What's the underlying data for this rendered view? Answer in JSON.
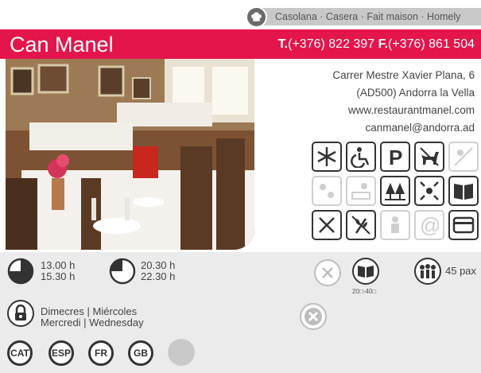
{
  "cuisine": "Casolana · Casera · Fait maison · Homely",
  "restaurant": {
    "name": "Can Manel"
  },
  "phones": {
    "t_label": "T.",
    "t_number": "(+376) 822 397",
    "f_label": "F.",
    "f_number": "(+376) 861 504"
  },
  "address": {
    "line1": "Carrer Mestre Xavier Plana, 6",
    "line2": "(AD500) Andorra la Vella",
    "web": "www.restaurantmanel.com",
    "email": "canmanel@andorra.ad"
  },
  "services": [
    {
      "icon": "snowflake-icon",
      "active": true
    },
    {
      "icon": "wheelchair-icon",
      "active": true
    },
    {
      "icon": "parking-icon",
      "active": true
    },
    {
      "icon": "dog-icon",
      "active": true
    },
    {
      "icon": "terrace-icon",
      "active": false
    },
    {
      "icon": "sun-icon",
      "active": false
    },
    {
      "icon": "terrace-view-icon",
      "active": false
    },
    {
      "icon": "trees-icon",
      "active": true
    },
    {
      "icon": "kids-icon",
      "active": true
    },
    {
      "icon": "menu-book-icon",
      "active": true
    },
    {
      "icon": "cutlery-icon",
      "active": true
    },
    {
      "icon": "gluten-free-icon",
      "active": true
    },
    {
      "icon": "chef-icon",
      "active": false
    },
    {
      "icon": "at-icon",
      "active": false
    },
    {
      "icon": "credit-card-icon",
      "active": true
    }
  ],
  "hours": {
    "lunch_open": "13.00 h",
    "lunch_close": "15.30 h",
    "dinner_open": "20.30 h",
    "dinner_close": "22.30 h"
  },
  "menu_price": "20□-40□",
  "capacity": "45 pax",
  "closed": {
    "line1": "Dimecres | Miércoles",
    "line2": "Mercredi | Wednesday"
  },
  "languages": [
    "CAT",
    "ESP",
    "FR",
    "GB"
  ],
  "colors": {
    "brand": "#e4154b",
    "panel": "#ebebeb",
    "strip": "#c8c8c8"
  }
}
